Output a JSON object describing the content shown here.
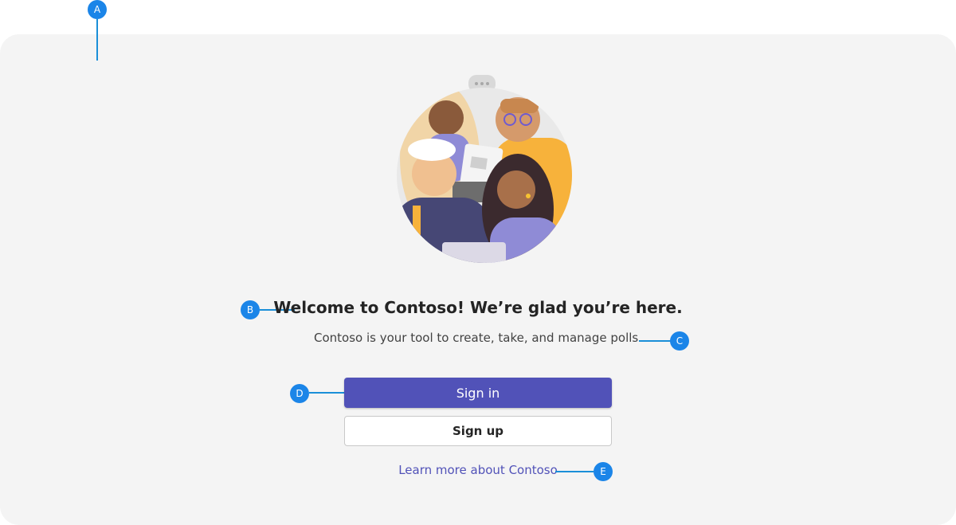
{
  "welcome": {
    "title": "Welcome to Contoso! We’re glad you’re here.",
    "subtitle": "Contoso is your tool to create, take, and manage polls.",
    "sign_in_label": "Sign in",
    "sign_up_label": "Sign up",
    "learn_more_label": "Learn more about Contoso"
  },
  "callouts": {
    "a": "A",
    "b": "B",
    "c": "C",
    "d": "D",
    "e": "E"
  },
  "colors": {
    "accent": "#5152b8",
    "callout": "#1b85e8",
    "panel_background": "#f4f4f4"
  }
}
